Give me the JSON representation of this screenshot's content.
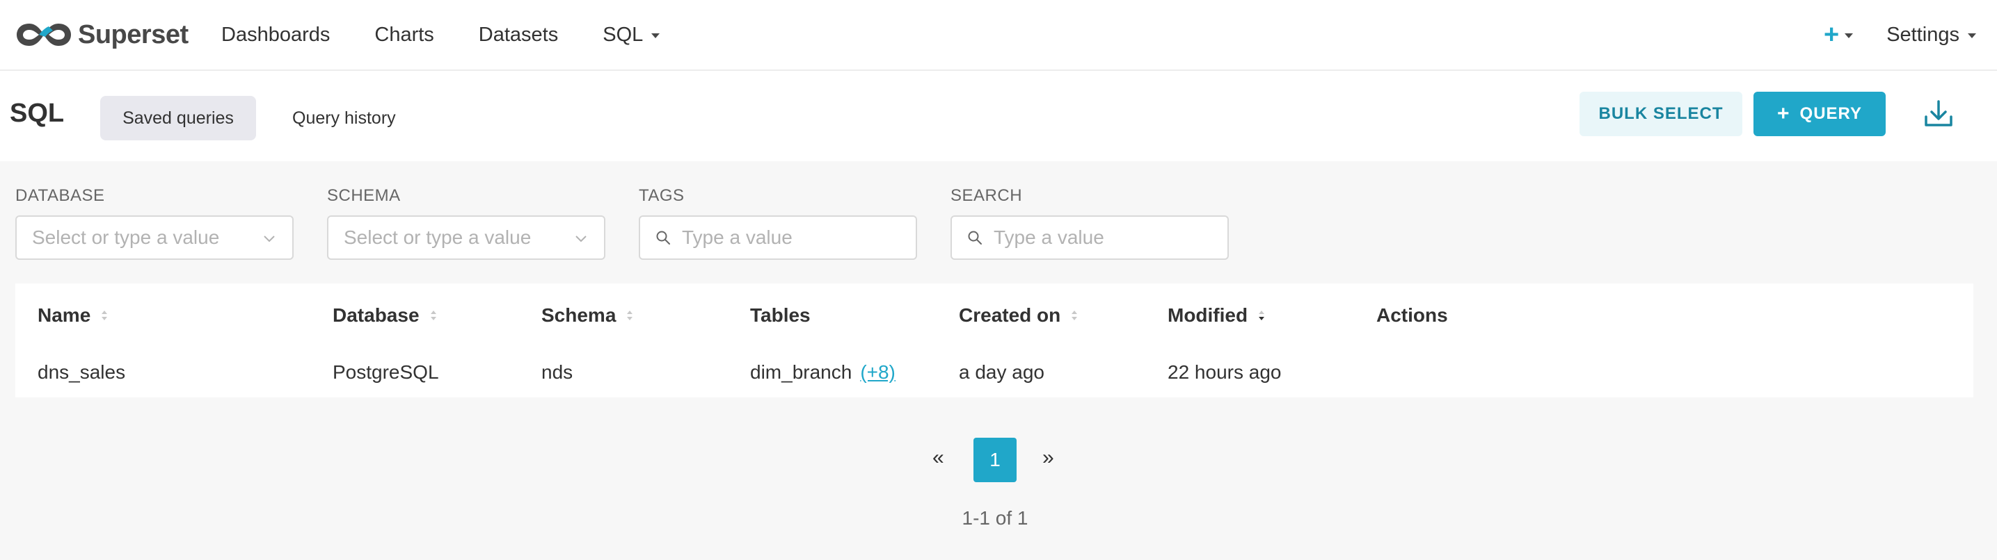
{
  "brand": {
    "name": "Superset"
  },
  "nav": {
    "items": [
      {
        "label": "Dashboards"
      },
      {
        "label": "Charts"
      },
      {
        "label": "Datasets"
      },
      {
        "label": "SQL"
      }
    ],
    "settings_label": "Settings"
  },
  "subheader": {
    "title": "SQL",
    "tabs": [
      {
        "label": "Saved queries",
        "active": true
      },
      {
        "label": "Query history",
        "active": false
      }
    ],
    "bulk_select_label": "BULK SELECT",
    "query_label": "QUERY"
  },
  "filters": {
    "database": {
      "label": "DATABASE",
      "placeholder": "Select or type a value"
    },
    "schema": {
      "label": "SCHEMA",
      "placeholder": "Select or type a value"
    },
    "tags": {
      "label": "TAGS",
      "placeholder": "Type a value"
    },
    "search": {
      "label": "SEARCH",
      "placeholder": "Type a value"
    }
  },
  "table": {
    "columns": [
      {
        "label": "Name"
      },
      {
        "label": "Database"
      },
      {
        "label": "Schema"
      },
      {
        "label": "Tables"
      },
      {
        "label": "Created on"
      },
      {
        "label": "Modified"
      },
      {
        "label": "Actions"
      }
    ],
    "rows": [
      {
        "name": "dns_sales",
        "database": "PostgreSQL",
        "schema": "nds",
        "tables": "dim_branch",
        "tables_more": "(+8)",
        "created_on": "a day ago",
        "modified": "22 hours ago"
      }
    ]
  },
  "pagination": {
    "prev": "«",
    "current": "1",
    "next": "»",
    "summary": "1-1 of 1"
  },
  "colors": {
    "primary": "#20a7c9",
    "primary_light": "#e9f6f9",
    "text": "#323232",
    "muted": "#666666"
  }
}
